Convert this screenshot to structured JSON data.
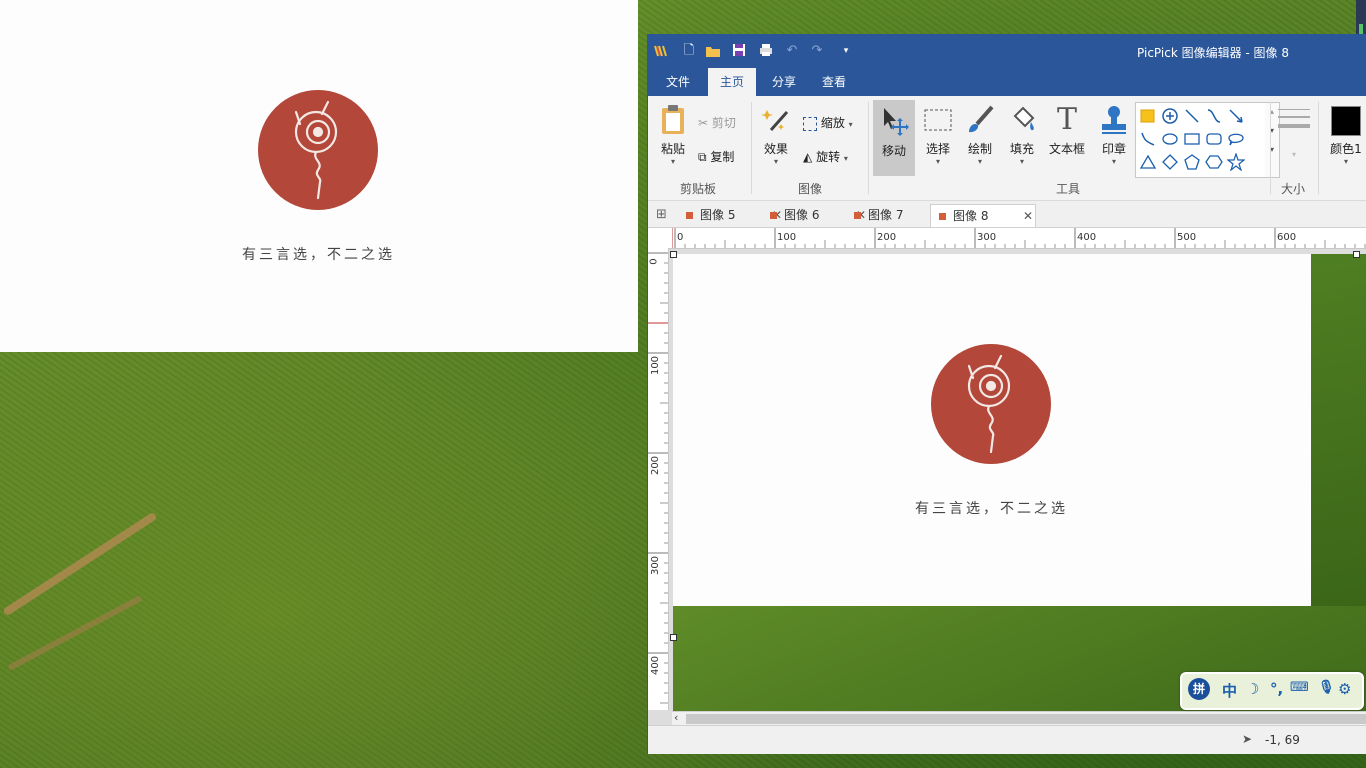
{
  "preview": {
    "slogan": "有三言选，不二之选",
    "logo_color": "#b2473a"
  },
  "window": {
    "title": "PicPick 图像编辑器 - 图像 8",
    "accent": "#2b579a",
    "quick_access": [
      "new-file-icon",
      "open-folder-icon",
      "save-icon",
      "print-icon",
      "undo-icon",
      "redo-icon",
      "customize-dropdown-icon"
    ]
  },
  "menu": {
    "tabs": [
      "文件",
      "主页",
      "分享",
      "查看"
    ],
    "active": "主页"
  },
  "ribbon": {
    "paste": "粘贴",
    "cut": "剪切",
    "copy": "复制",
    "clipboard_group": "剪贴板",
    "effects": "效果",
    "resize": "缩放",
    "rotate": "旋转",
    "image_group": "图像",
    "move": "移动",
    "select": "选择",
    "draw": "绘制",
    "fill": "填充",
    "textbox": "文本框",
    "stamp": "印章",
    "tools_group": "工具",
    "size_group": "大小",
    "color1": "颜色1",
    "color1_value": "#000000"
  },
  "doc_tabs": [
    {
      "label": "图像 5"
    },
    {
      "label": "图像 6"
    },
    {
      "label": "图像 7"
    },
    {
      "label": "图像 8",
      "active": true
    }
  ],
  "ruler": {
    "h_labels": [
      "0",
      "100",
      "200",
      "300",
      "400",
      "500",
      "600"
    ],
    "v_labels": [
      "0",
      "100",
      "200",
      "300",
      "400"
    ]
  },
  "canvas": {
    "slogan": "有三言选，不二之选"
  },
  "status": {
    "coords": "-1, 69"
  },
  "ime": {
    "mode": "中",
    "items": [
      "ime-logo-icon",
      "chinese-mode",
      "half-width-moon-icon",
      "punctuation-icon",
      "soft-keyboard-icon",
      "microphone-icon",
      "settings-gear-icon"
    ]
  }
}
